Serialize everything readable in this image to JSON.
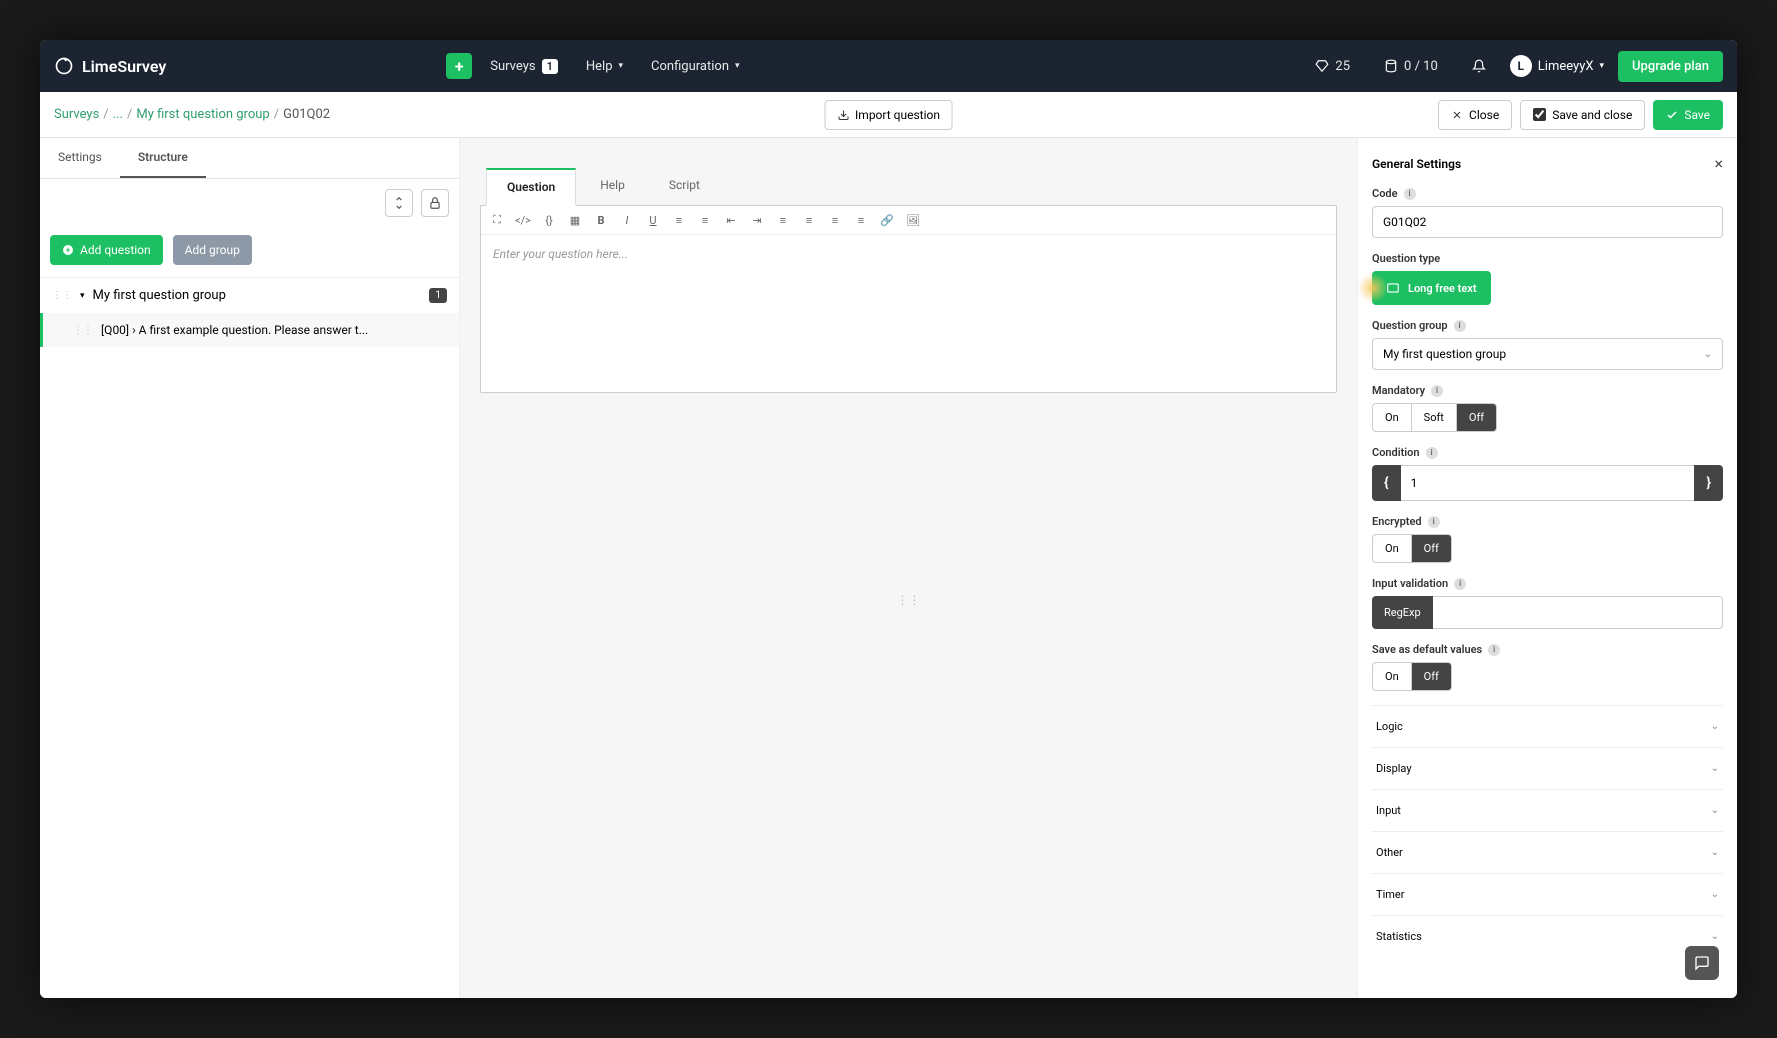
{
  "topbar": {
    "brand": "LimeSurvey",
    "surveys_label": "Surveys",
    "surveys_count": "1",
    "help_label": "Help",
    "config_label": "Configuration",
    "diamond_count": "25",
    "storage": "0 / 10",
    "user": "LimeeyyX",
    "upgrade": "Upgrade plan"
  },
  "subbar": {
    "crumb_surveys": "Surveys",
    "crumb_dots": "...",
    "crumb_group": "My first question group",
    "crumb_current": "G01Q02",
    "import": "Import question",
    "close": "Close",
    "savec": "Save and close",
    "save": "Save"
  },
  "tabs": {
    "settings": "Settings",
    "structure": "Structure"
  },
  "left": {
    "add_q": "Add question",
    "add_g": "Add group",
    "group_name": "My first question group",
    "group_count": "1",
    "item1": "[Q00] › A first example question. Please answer t..."
  },
  "editor": {
    "tab_q": "Question",
    "tab_h": "Help",
    "tab_s": "Script",
    "placeholder": "Enter your question here..."
  },
  "right": {
    "title": "General Settings",
    "code_label": "Code",
    "code_value": "G01Q02",
    "qtype_label": "Question type",
    "qtype_value": "Long free text",
    "qgroup_label": "Question group",
    "qgroup_value": "My first question group",
    "mandatory_label": "Mandatory",
    "on": "On",
    "soft": "Soft",
    "off": "Off",
    "condition_label": "Condition",
    "condition_value": "1",
    "encrypted_label": "Encrypted",
    "inputval_label": "Input validation",
    "regexp": "RegExp",
    "savedef_label": "Save as default values",
    "acc": {
      "logic": "Logic",
      "display": "Display",
      "input": "Input",
      "other": "Other",
      "timer": "Timer",
      "statistics": "Statistics"
    }
  }
}
